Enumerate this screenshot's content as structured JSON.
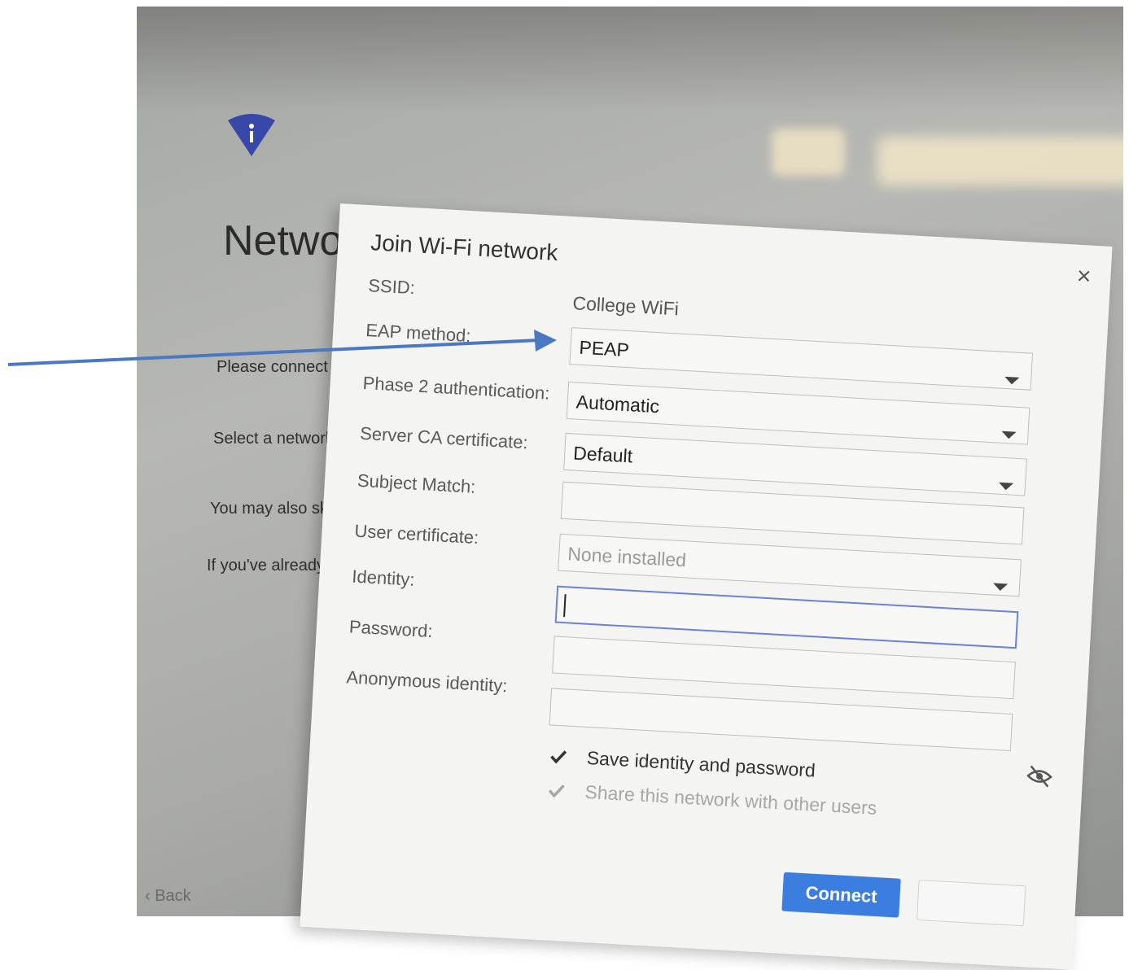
{
  "background_screen": {
    "title": "Networ",
    "lines": [
      "Please connect t",
      "Select a network:",
      "You may also ski",
      "If you've already r"
    ],
    "back_label": "Back",
    "icon": "wifi-info-icon"
  },
  "dialog": {
    "title": "Join Wi-Fi network",
    "close_glyph": "×",
    "labels": {
      "ssid": "SSID:",
      "eap_method": "EAP method:",
      "phase2": "Phase 2 authentication:",
      "server_ca": "Server CA certificate:",
      "subject_match": "Subject Match:",
      "user_certificate": "User certificate:",
      "identity": "Identity:",
      "password": "Password:",
      "anonymous_identity": "Anonymous identity:"
    },
    "values": {
      "ssid": "College WiFi",
      "eap_method": "PEAP",
      "phase2": "Automatic",
      "server_ca": "Default",
      "subject_match": "",
      "user_certificate": "None installed",
      "identity": "",
      "password": "",
      "anonymous_identity": ""
    },
    "checkboxes": {
      "save_identity": {
        "label": "Save identity and password",
        "checked": true
      },
      "share_network": {
        "label": "Share this network with other users",
        "checked": true,
        "disabled": true
      }
    },
    "connect_label": "Connect"
  },
  "colors": {
    "accent": "#3b7ee0",
    "focus_border": "#6b82d6",
    "annotation_arrow": "#4a78c2",
    "icon_blue": "#3848a8"
  }
}
